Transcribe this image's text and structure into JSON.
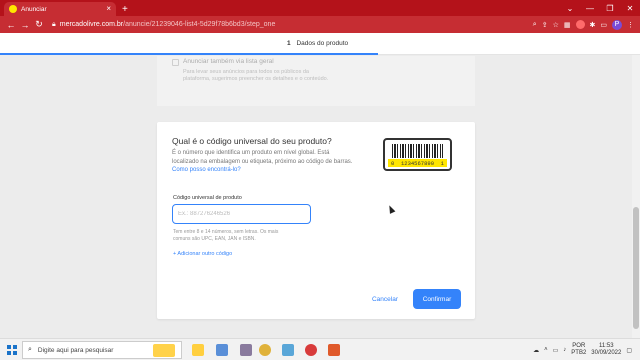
{
  "browser": {
    "tab_title": "Anunciar",
    "tab_close": "×",
    "new_tab": "+",
    "url_host": "mercadolivre.com.br",
    "url_path": "/anuncie/21239046-list4-5d29f78b6bd3/step_one",
    "window_controls": [
      "⌄",
      "—",
      "❐",
      "✕"
    ]
  },
  "step": {
    "number": "1",
    "label": "Dados do produto",
    "progress_percent": 59
  },
  "previous_section": {
    "title": "Anunciar também via lista geral",
    "description": "Para levar seus anúncios para todos os públicos da plataforma, sugerimos preencher os detalhes e o conteúdo."
  },
  "form": {
    "title": "Qual é o código universal do seu produto?",
    "description": "É o número que identifica um produto em nível global. Está localizado na embalagem ou etiqueta, próximo ao código de barras.",
    "help_link": "Como posso encontrá-lo?",
    "barcode_left": "0",
    "barcode_digits": "1234567890",
    "barcode_right": "1",
    "field_label": "Código universal de produto",
    "field_placeholder": "Ex.: 887276246526",
    "field_value": "",
    "field_help": "Tem entre 8 e 14 números, sem letras. Os mais comuns são UPC, EAN, JAN e ISBN.",
    "add_code_link": "+ Adicionar outro código",
    "cancel_label": "Cancelar",
    "confirm_label": "Confirmar"
  },
  "taskbar": {
    "search_placeholder": "Digite aqui para pesquisar",
    "lang_top": "POR",
    "lang_bottom": "PTB2",
    "time": "11:53",
    "date": "30/09/2022"
  },
  "colors": {
    "brand_red": "#c62d33",
    "accent_blue": "#3483fa",
    "barcode_yellow": "#ffe600"
  }
}
